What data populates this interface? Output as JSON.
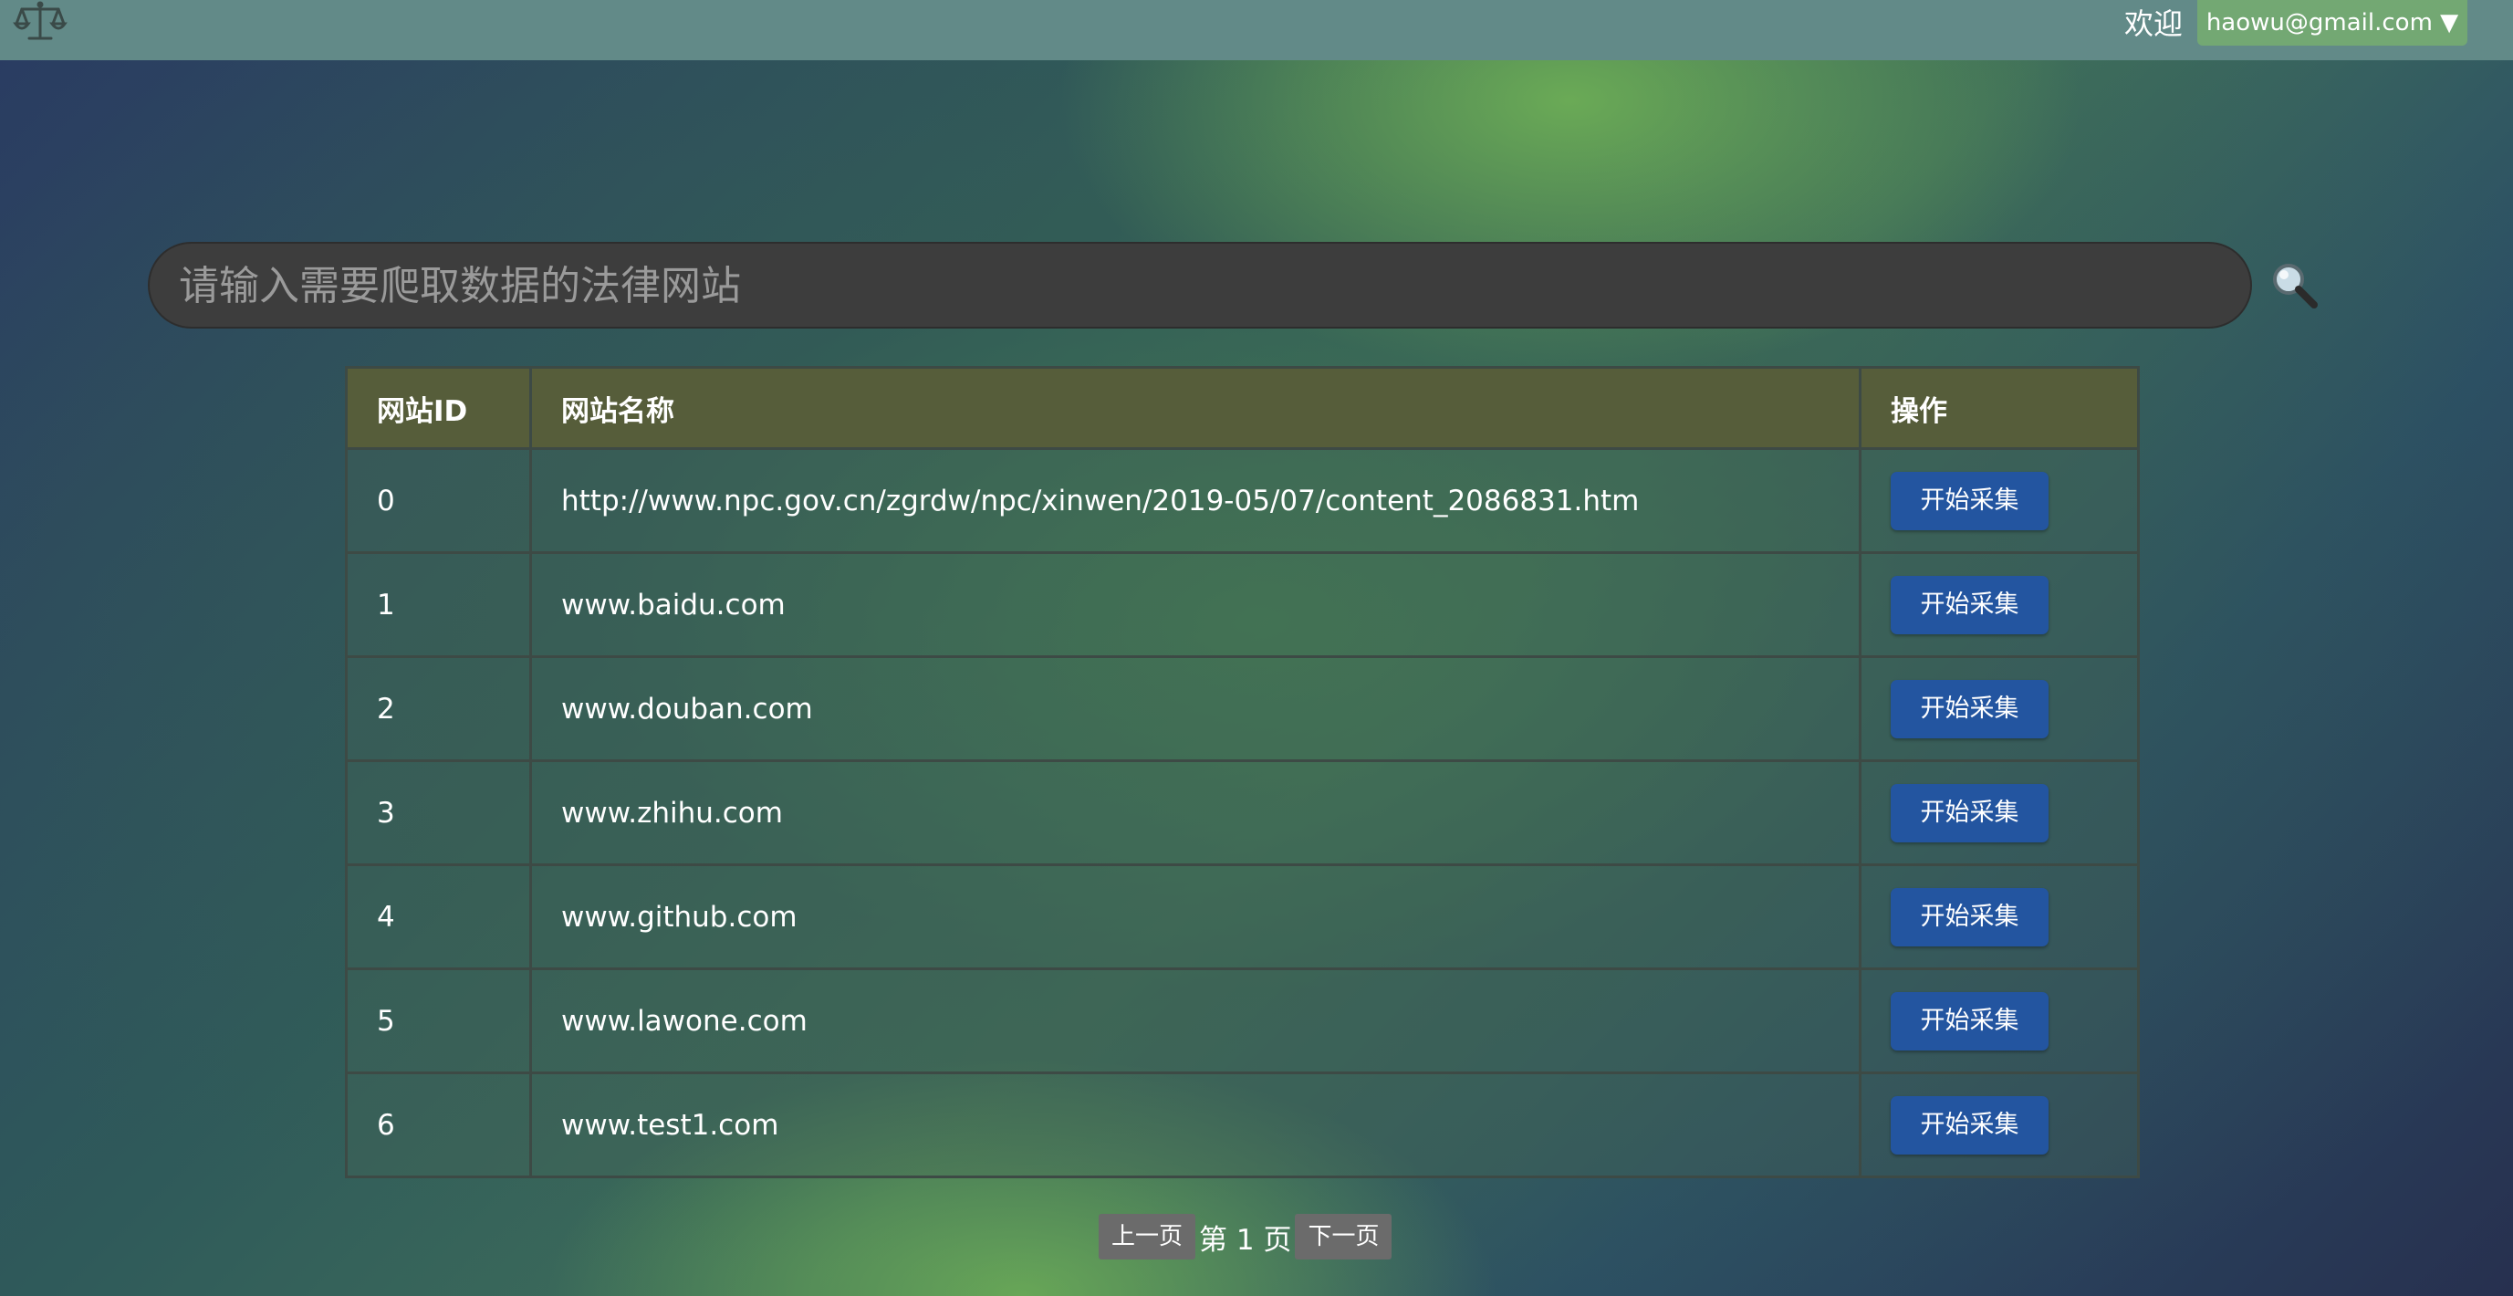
{
  "header": {
    "logo_icon": "scales-of-justice-icon",
    "welcome_text": "欢迎",
    "user_email": "haowu@gmail.com ▼"
  },
  "search": {
    "placeholder": "请输入需要爬取数据的法律网站",
    "value": "",
    "search_icon": "magnifier-icon"
  },
  "table": {
    "headers": [
      "网站ID",
      "网站名称",
      "操作"
    ],
    "rows": [
      {
        "id": "0",
        "name": "http://www.npc.gov.cn/zgrdw/npc/xinwen/2019-05/07/content_2086831.htm",
        "action": "开始采集"
      },
      {
        "id": "1",
        "name": "www.baidu.com",
        "action": "开始采集"
      },
      {
        "id": "2",
        "name": "www.douban.com",
        "action": "开始采集"
      },
      {
        "id": "3",
        "name": "www.zhihu.com",
        "action": "开始采集"
      },
      {
        "id": "4",
        "name": "www.github.com",
        "action": "开始采集"
      },
      {
        "id": "5",
        "name": "www.lawone.com",
        "action": "开始采集"
      },
      {
        "id": "6",
        "name": "www.test1.com",
        "action": "开始采集"
      }
    ]
  },
  "pagination": {
    "prev_label": "上一页",
    "page_text": "第 1 页",
    "next_label": "下一页"
  },
  "colors": {
    "topbar": "#628a88",
    "user_menu": "#73a873",
    "table_header": "#565d3a",
    "action_button": "#2355a0",
    "search_bar": "#3d3d3d"
  }
}
